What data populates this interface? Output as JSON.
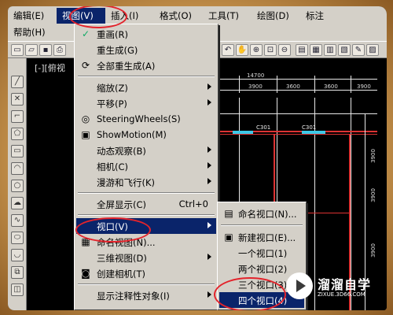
{
  "menubar": {
    "row1": [
      {
        "label": "编辑(E)"
      },
      {
        "label": "视图(V)"
      },
      {
        "label": "插入(I)"
      },
      {
        "label": "格式(O)"
      },
      {
        "label": "工具(T)"
      },
      {
        "label": "绘图(D)"
      },
      {
        "label": "标注"
      }
    ],
    "row2": [
      {
        "label": "帮助(H)"
      }
    ]
  },
  "canvas": {
    "view_label": "[-][俯视",
    "dims": [
      "14700",
      "3900",
      "3600",
      "3600",
      "3900"
    ],
    "bubbles": [
      "C301",
      "C301"
    ],
    "side_dims": [
      "3900",
      "3900",
      "3900"
    ]
  },
  "view_menu": {
    "items": [
      {
        "icon": "✓",
        "label": "重画(R)",
        "shortcut": ""
      },
      {
        "icon": "",
        "label": "重生成(G)",
        "shortcut": ""
      },
      {
        "icon": "",
        "label": "全部重生成(A)",
        "shortcut": ""
      },
      {
        "icon": "",
        "label": "缩放(Z)",
        "shortcut": "",
        "submenu": true
      },
      {
        "icon": "",
        "label": "平移(P)",
        "shortcut": "",
        "submenu": true
      },
      {
        "icon": "◎",
        "label": "SteeringWheels(S)",
        "shortcut": ""
      },
      {
        "icon": "▣",
        "label": "ShowMotion(M)",
        "shortcut": ""
      },
      {
        "icon": "",
        "label": "动态观察(B)",
        "shortcut": "",
        "submenu": true
      },
      {
        "icon": "",
        "label": "相机(C)",
        "shortcut": "",
        "submenu": true
      },
      {
        "icon": "",
        "label": "漫游和飞行(K)",
        "shortcut": "",
        "submenu": true
      },
      {
        "icon": "",
        "label": "全屏显示(C)",
        "shortcut": "Ctrl+0"
      },
      {
        "icon": "",
        "label": "视口(V)",
        "shortcut": "",
        "submenu": true
      },
      {
        "icon": "▦",
        "label": "命名视图(N)...",
        "shortcut": ""
      },
      {
        "icon": "",
        "label": "三维视图(D)",
        "shortcut": "",
        "submenu": true
      },
      {
        "icon": "◙",
        "label": "创建相机(T)",
        "shortcut": ""
      },
      {
        "icon": "",
        "label": "显示注释性对象(I)",
        "shortcut": "",
        "submenu": true
      }
    ]
  },
  "viewport_submenu": {
    "items": [
      {
        "icon": "▤",
        "label": "命名视口(N)..."
      },
      {
        "icon": "▣",
        "label": "新建视口(E)..."
      },
      {
        "icon": "",
        "label": "一个视口(1)"
      },
      {
        "icon": "",
        "label": "两个视口(2)"
      },
      {
        "icon": "",
        "label": "三个视口(3)"
      },
      {
        "icon": "",
        "label": "四个视口(4)"
      }
    ]
  },
  "watermark": {
    "title": "溜溜自学",
    "url": "ZIXUE.3D66.COM"
  },
  "colors": {
    "highlight": "#0a246a",
    "annotation_circle": "#e3232b",
    "menu_bg": "#d4d0c8"
  }
}
